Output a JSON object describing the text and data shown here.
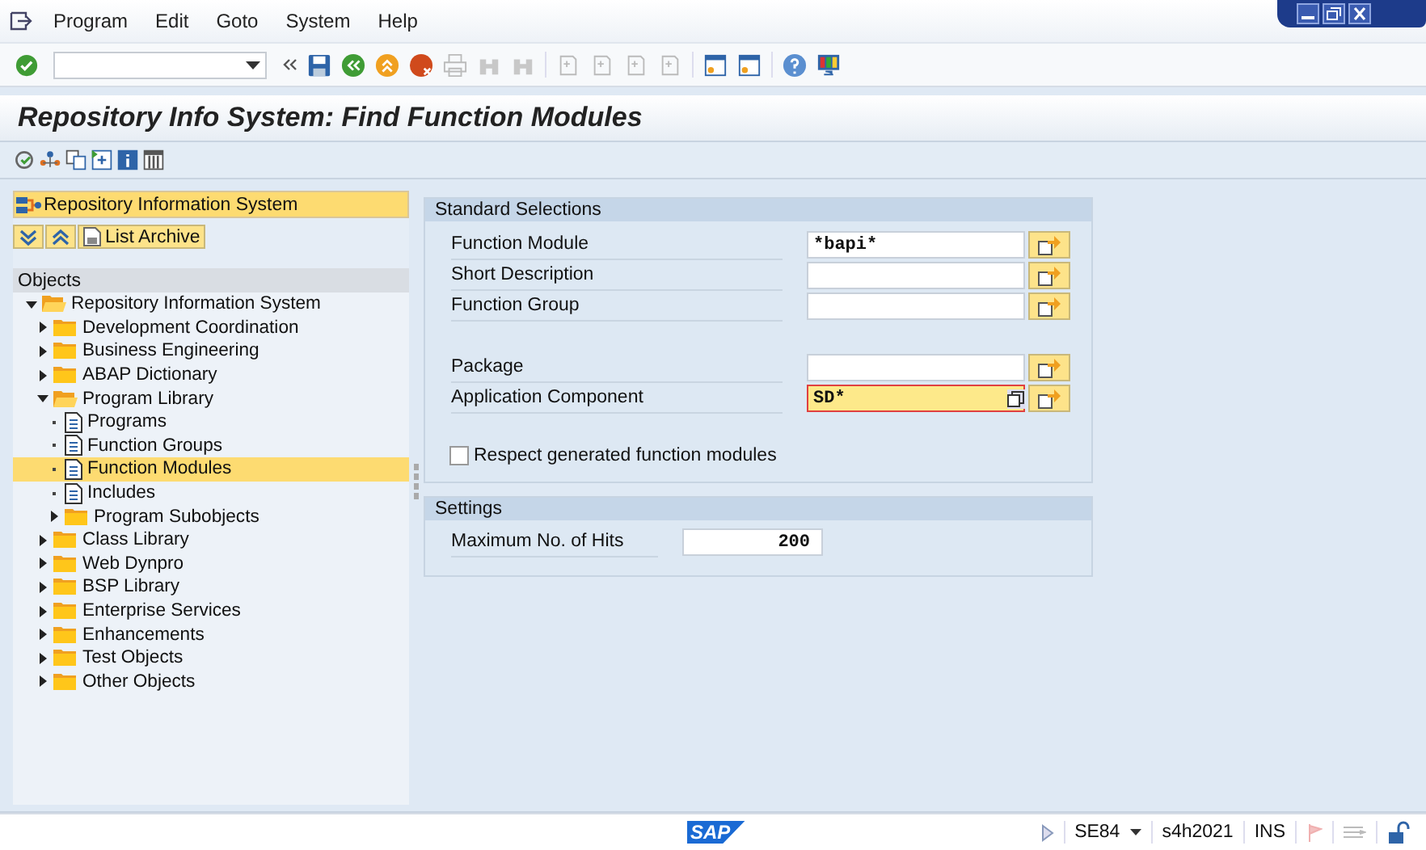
{
  "menu": [
    "Program",
    "Edit",
    "Goto",
    "System",
    "Help"
  ],
  "title": "Repository Info System: Find Function Modules",
  "navigator": {
    "header": "Repository Information System",
    "list_archive": "List Archive",
    "objects_header": "Objects",
    "tree": [
      {
        "label": "Repository Information System",
        "kind": "folder",
        "expanded": true,
        "selected": false,
        "children": [
          {
            "label": "Development Coordination",
            "kind": "folder",
            "expanded": false,
            "selected": false
          },
          {
            "label": "Business Engineering",
            "kind": "folder",
            "expanded": false,
            "selected": false
          },
          {
            "label": "ABAP Dictionary",
            "kind": "folder",
            "expanded": false,
            "selected": false
          },
          {
            "label": "Program Library",
            "kind": "folder",
            "expanded": true,
            "selected": false,
            "children": [
              {
                "label": "Programs",
                "kind": "document",
                "expanded": false,
                "selected": false
              },
              {
                "label": "Function Groups",
                "kind": "document",
                "expanded": false,
                "selected": false
              },
              {
                "label": "Function Modules",
                "kind": "document",
                "expanded": false,
                "selected": true
              },
              {
                "label": "Includes",
                "kind": "document",
                "expanded": false,
                "selected": false
              },
              {
                "label": "Program Subobjects",
                "kind": "folder",
                "expanded": false,
                "selected": false
              }
            ]
          },
          {
            "label": "Class Library",
            "kind": "folder",
            "expanded": false,
            "selected": false
          },
          {
            "label": "Web Dynpro",
            "kind": "folder",
            "expanded": false,
            "selected": false
          },
          {
            "label": "BSP Library",
            "kind": "folder",
            "expanded": false,
            "selected": false
          },
          {
            "label": "Enterprise Services",
            "kind": "folder",
            "expanded": false,
            "selected": false
          },
          {
            "label": "Enhancements",
            "kind": "folder",
            "expanded": false,
            "selected": false
          },
          {
            "label": "Test Objects",
            "kind": "folder",
            "expanded": false,
            "selected": false
          },
          {
            "label": "Other Objects",
            "kind": "folder",
            "expanded": false,
            "selected": false
          }
        ]
      }
    ]
  },
  "standard_selections": {
    "title": "Standard Selections",
    "field_groups": [
      [
        {
          "label": "Function Module",
          "value": "*bapi*",
          "focused": false
        },
        {
          "label": "Short Description",
          "focused": false
        },
        {
          "label": "Function Group",
          "focused": false
        }
      ],
      [
        {
          "label": "Package",
          "focused": false
        },
        {
          "label": "Application Component",
          "value": "SD*",
          "focused": true
        }
      ]
    ],
    "checkbox": {
      "label": "Respect generated function modules",
      "checked": false
    }
  },
  "settings": {
    "title": "Settings",
    "label": "Maximum No. of Hits",
    "value": "200"
  },
  "status_bar": {
    "logo": "SAP",
    "transaction": "SE84",
    "system": "s4h2021",
    "mode": "INS"
  }
}
